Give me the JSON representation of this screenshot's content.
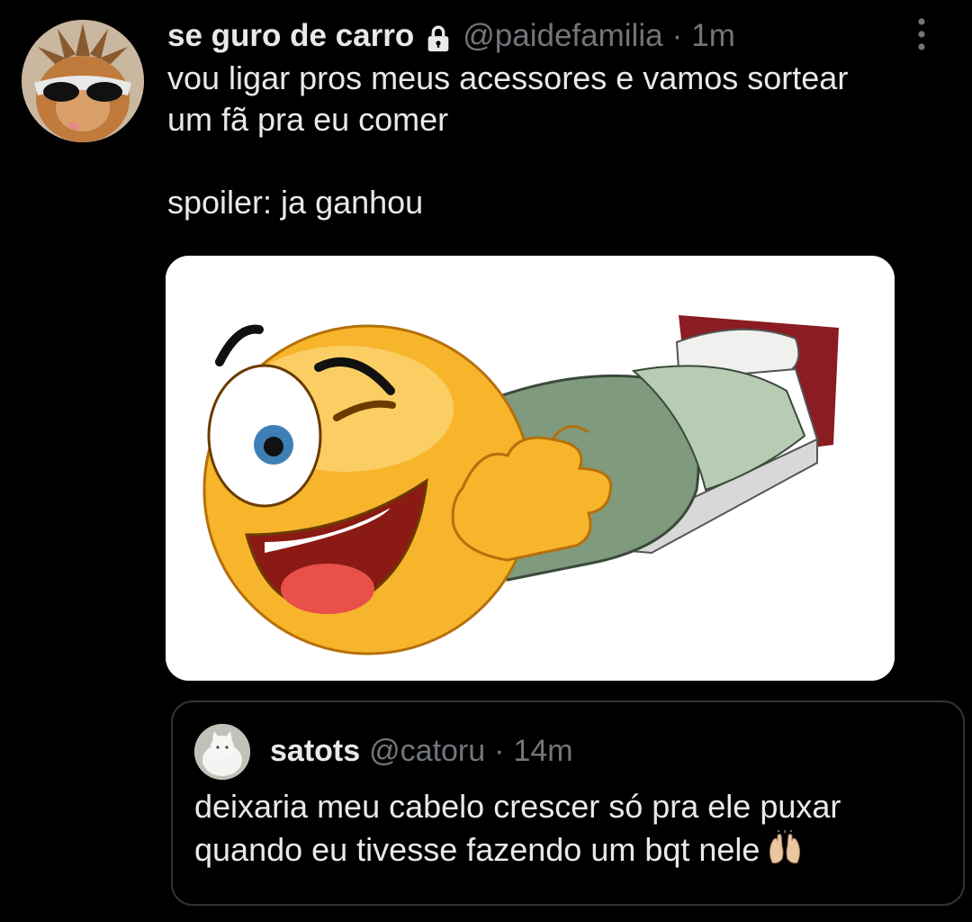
{
  "tweet": {
    "author": {
      "display_name": "se guro de carro",
      "handle": "@paidefamilia",
      "protected_icon": "lock-icon"
    },
    "separator": "·",
    "time": "1m",
    "more_icon": "vertical-ellipsis-icon",
    "text_lines": [
      "vou ligar pros meus acessores e vamos sortear",
      "um fã pra eu comer",
      "spoiler: ja ganhou"
    ],
    "media": {
      "description_icon": "winking-emoji-on-bed-image"
    }
  },
  "quoted_tweet": {
    "author": {
      "display_name": "satots",
      "handle": "@catoru"
    },
    "separator": "·",
    "time": "14m",
    "text_lines": [
      "deixaria meu cabelo crescer só pra ele puxar",
      "quando eu tivesse fazendo um bqt nele"
    ],
    "emoji": "raising-hands-icon"
  },
  "colors": {
    "background": "#000000",
    "text": "#e7e9ea",
    "secondary": "#71767b",
    "border": "#2f3336"
  }
}
